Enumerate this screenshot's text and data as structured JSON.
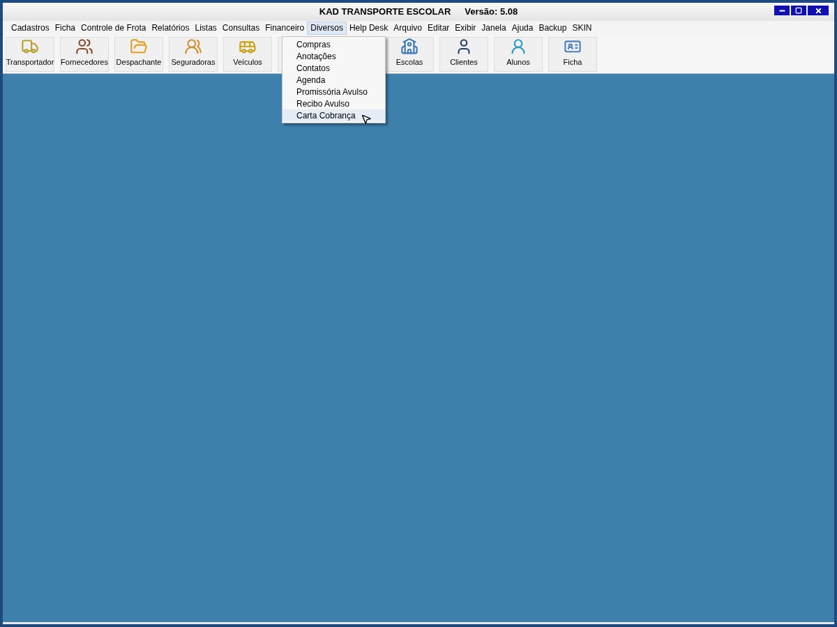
{
  "window": {
    "title": "KAD TRANSPORTE ESCOLAR",
    "version": "Versão: 5.08"
  },
  "menu_bar": [
    {
      "label": "Cadastros",
      "selected": false
    },
    {
      "label": "Ficha",
      "selected": false
    },
    {
      "label": "Controle de Frota",
      "selected": false
    },
    {
      "label": "Relatórios",
      "selected": false
    },
    {
      "label": "Listas",
      "selected": false
    },
    {
      "label": "Consultas",
      "selected": false
    },
    {
      "label": "Financeiro",
      "selected": false
    },
    {
      "label": "Diversos",
      "selected": true
    },
    {
      "label": "Help Desk",
      "selected": false
    },
    {
      "label": "Arquivo",
      "selected": false
    },
    {
      "label": "Editar",
      "selected": false
    },
    {
      "label": "Exibir",
      "selected": false
    },
    {
      "label": "Janela",
      "selected": false
    },
    {
      "label": "Ajuda",
      "selected": false
    },
    {
      "label": "Backup",
      "selected": false
    },
    {
      "label": "SKIN",
      "selected": false
    }
  ],
  "toolbar": [
    {
      "kind": "truck",
      "label": "Transportador"
    },
    {
      "kind": "people",
      "label": "Fornecedores"
    },
    {
      "kind": "folder",
      "label": "Despachante"
    },
    {
      "kind": "group",
      "label": "Seguradoras"
    },
    {
      "kind": "bus",
      "label": "Veículos"
    },
    {
      "kind": "hidden"
    },
    {
      "kind": "school",
      "label": "Escolas"
    },
    {
      "kind": "client",
      "label": "Clientes"
    },
    {
      "kind": "student",
      "label": "Alunos"
    },
    {
      "kind": "card",
      "label": "Ficha"
    }
  ],
  "dropdown": [
    {
      "label": "Compras",
      "selected": false
    },
    {
      "label": "Anotações",
      "selected": false
    },
    {
      "label": "Contatos",
      "selected": false
    },
    {
      "label": "Agenda",
      "selected": false
    },
    {
      "label": "Promissória Avulso",
      "selected": false
    },
    {
      "label": "Recibo Avulso",
      "selected": false
    },
    {
      "label": "Carta Cobrança",
      "selected": true
    }
  ]
}
